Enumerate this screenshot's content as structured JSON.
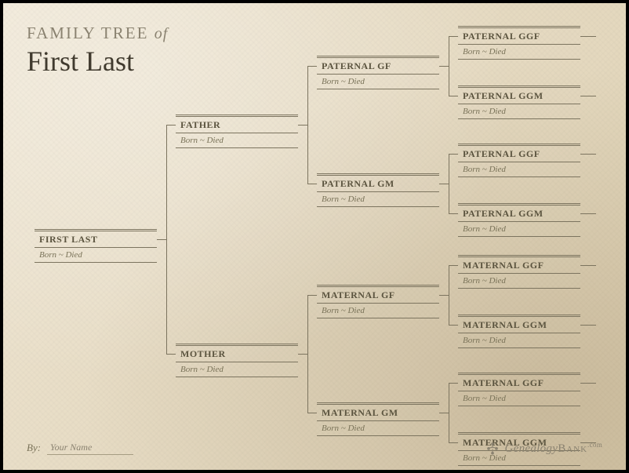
{
  "title": {
    "prefix": "FAMILY TREE",
    "of": "of",
    "name": "First Last"
  },
  "tree": {
    "root": {
      "name": "FIRST LAST",
      "dates": "Born ~ Died"
    },
    "father": {
      "name": "FATHER",
      "dates": "Born ~ Died"
    },
    "mother": {
      "name": "MOTHER",
      "dates": "Born ~ Died"
    },
    "pgf": {
      "name": "PATERNAL GF",
      "dates": "Born ~ Died"
    },
    "pgm": {
      "name": "PATERNAL GM",
      "dates": "Born ~ Died"
    },
    "mgf": {
      "name": "MATERNAL GF",
      "dates": "Born ~ Died"
    },
    "mgm": {
      "name": "MATERNAL GM",
      "dates": "Born ~ Died"
    },
    "pggf1": {
      "name": "PATERNAL GGF",
      "dates": "Born ~ Died"
    },
    "pggm1": {
      "name": "PATERNAL GGM",
      "dates": "Born ~ Died"
    },
    "pggf2": {
      "name": "PATERNAL GGF",
      "dates": "Born ~ Died"
    },
    "pggm2": {
      "name": "PATERNAL GGM",
      "dates": "Born ~ Died"
    },
    "mggf1": {
      "name": "MATERNAL GGF",
      "dates": "Born ~ Died"
    },
    "mggm1": {
      "name": "MATERNAL GGM",
      "dates": "Born ~ Died"
    },
    "mggf2": {
      "name": "MATERNAL GGF",
      "dates": "Born ~ Died"
    },
    "mggm2": {
      "name": "MATERNAL GGM",
      "dates": "Born ~ Died"
    }
  },
  "footer": {
    "by_label": "By:",
    "by_value": "Your Name",
    "brand_a": "Genealogy",
    "brand_b": "Bank",
    "brand_c": ".com"
  }
}
